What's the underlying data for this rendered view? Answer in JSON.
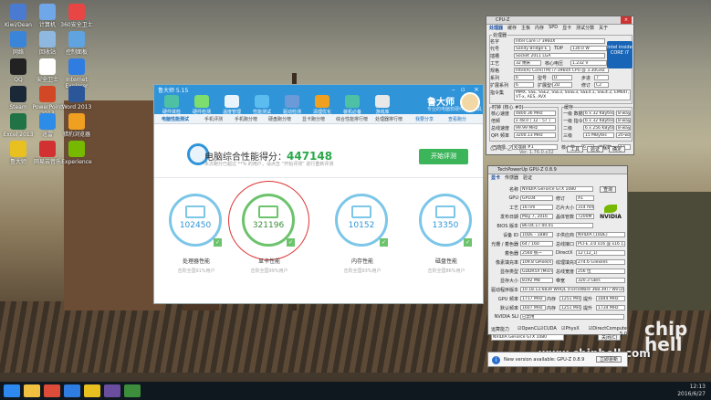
{
  "desktop": {
    "icons": [
      {
        "label": "Kiwi/Dean",
        "color": "#4a7bd0"
      },
      {
        "label": "计算机",
        "color": "#6fa7e8"
      },
      {
        "label": "360安全卫士",
        "color": "#e84545"
      },
      {
        "label": "网络",
        "color": "#3b85d8"
      },
      {
        "label": "回收站",
        "color": "#8fb8e0"
      },
      {
        "label": "控制面板",
        "color": "#5fa3e0"
      },
      {
        "label": "QQ",
        "color": "#222222"
      },
      {
        "label": "安全卫士",
        "color": "#ffffff"
      },
      {
        "label": "Internet Explorer",
        "color": "#2f7de1"
      },
      {
        "label": "Steam",
        "color": "#1b2838"
      },
      {
        "label": "PowerPoint 2013",
        "color": "#d24726"
      },
      {
        "label": "Word 2013",
        "color": "#2b579a"
      },
      {
        "label": "Excel 2013",
        "color": "#217346"
      },
      {
        "label": "迅雷",
        "color": "#2d8ce8"
      },
      {
        "label": "猎豹浏览器",
        "color": "#f0a020"
      },
      {
        "label": "鲁大师",
        "color": "#e8c020"
      },
      {
        "label": "网易云音乐",
        "color": "#d23131"
      },
      {
        "label": "Experience",
        "color": "#76b900"
      }
    ],
    "watermark": "www.chiphell.com",
    "logo_text": "chip hell"
  },
  "taskbar": {
    "time": "12:13",
    "date": "2016/6/27",
    "apps": [
      {
        "name": "start",
        "color": "#2d89ef"
      },
      {
        "name": "explorer",
        "color": "#f0c040"
      },
      {
        "name": "chrome",
        "color": "#dd4b39"
      },
      {
        "name": "ie",
        "color": "#2f7de1"
      },
      {
        "name": "ludashi",
        "color": "#e8c020"
      },
      {
        "name": "cpu-z",
        "color": "#6a4d9e"
      },
      {
        "name": "gpu-z",
        "color": "#3c8e3c"
      }
    ]
  },
  "ludashi": {
    "window_title": "鲁大师 5.15",
    "toolbar": [
      "硬件体检",
      "硬件检测",
      "温度管理",
      "性能测试",
      "驱动检测",
      "清理优化",
      "装机必备",
      "游戏库"
    ],
    "toolbar_colors": [
      "#4ec1a5",
      "#7ddd6f",
      "#e8f3fb",
      "#5bbcf0",
      "#6a9ad8",
      "#f0a020",
      "#4ec1a5",
      "#e8e8e8"
    ],
    "brand": "鲁大师",
    "brand_sub": "专业的电脑软硬件检测工具",
    "tabs": [
      "电脑性能测试",
      "手机评测",
      "手机跑分榜",
      "硬盘跑分榜",
      "显卡跑分榜",
      "综合性能排行榜",
      "处理器排行榜"
    ],
    "links": [
      "我要分享",
      "查看跑分"
    ],
    "score_label": "电脑综合性能得分：",
    "score": "447148",
    "subtitle": "本次跑分已超过 **% 的用户，请点击 “开始评测” 进行重新评测",
    "start_button": "开始评测",
    "tests": [
      {
        "value": "102450",
        "label": "处理器性能",
        "note": "击败全国91%用户"
      },
      {
        "value": "321196",
        "label": "显卡性能",
        "note": "击败全国99%用户"
      },
      {
        "value": "10152",
        "label": "内存性能",
        "note": "击败全国93%用户"
      },
      {
        "value": "13350",
        "label": "磁盘性能",
        "note": "击败全国86%用户"
      }
    ]
  },
  "cpuz": {
    "title": "CPU-Z",
    "tabs": [
      "处理器",
      "缓存",
      "主板",
      "内存",
      "SPD",
      "显卡",
      "测试分数",
      "关于"
    ],
    "group_processor": "处理器",
    "fields": [
      {
        "label": "名字",
        "value": "Intel Core i7 3960X"
      },
      {
        "label": "代号",
        "value": "Sandy Bridge-E"
      },
      {
        "label": "TDP",
        "value": "130.0 W"
      },
      {
        "label": "插槽",
        "value": "Socket 2011 LGA"
      },
      {
        "label": "工艺",
        "value": "32 纳米"
      },
      {
        "label": "核心电压",
        "value": "1.232 V"
      },
      {
        "label": "规格",
        "value": "Intel(R) Core(TM) i7-3960X CPU @ 3.30GHz"
      },
      {
        "label": "系列",
        "value": "6"
      },
      {
        "label": "型号",
        "value": "D"
      },
      {
        "label": "步进",
        "value": "7"
      },
      {
        "label": "扩展系列",
        "value": "6"
      },
      {
        "label": "扩展型号",
        "value": "2D"
      },
      {
        "label": "修订",
        "value": "C2"
      },
      {
        "label": "指令集",
        "value": "MMX, SSE, SSE2, SSE3, SSSE3, SSE4.1, SSE4.2, EM64T, VT-x, AES, AVX"
      }
    ],
    "clocks_title": "时钟 (核心 #0)",
    "clocks": [
      {
        "label": "核心速度",
        "value": "4800.36 MHz"
      },
      {
        "label": "倍频",
        "value": "x 48.0 ( 12 - 57 )"
      },
      {
        "label": "总线速度",
        "value": "99.99 MHz"
      },
      {
        "label": "QPI 频率",
        "value": "3200.13 MHz"
      }
    ],
    "cache_title": "缓存",
    "cache": [
      {
        "label": "一级 数据",
        "value": "6 x 32 KBytes",
        "way": "8-way"
      },
      {
        "label": "一级 指令",
        "value": "6 x 32 KBytes",
        "way": "8-way"
      },
      {
        "label": "二级",
        "value": "6 x 256 KBytes",
        "way": "8-way"
      },
      {
        "label": "三级",
        "value": "15 MBytes",
        "way": "20-way"
      }
    ],
    "selected_label": "已选择",
    "selected_value": "处理器 #1",
    "cores_label": "核心数",
    "cores": "6",
    "threads_label": "线程数",
    "threads": "12",
    "version": "Ver. 1.76.0.x32",
    "logo": "CPU-Z",
    "tools_button": "工具",
    "validate_button": "验证",
    "ok_button": "确定",
    "intel_badge": "intel inside CORE i7"
  },
  "gpuz": {
    "title": "TechPowerUp GPU-Z 0.8.9",
    "tabs": [
      "显卡",
      "传感器",
      "验证"
    ],
    "rows": [
      {
        "label": "名称",
        "value": "NVIDIA GeForce GTX 1080",
        "extra": "查询"
      },
      {
        "label": "GPU",
        "value": "GP104",
        "l2": "修订",
        "v2": "A1"
      },
      {
        "label": "工艺",
        "value": "16 nm",
        "l2": "芯片大小",
        "v2": "314 mm²"
      },
      {
        "label": "发布日期",
        "value": "May 7, 2016",
        "l2": "晶体管数",
        "v2": "7200M"
      },
      {
        "label": "BIOS 版本",
        "value": "86.04.17.00.01"
      },
      {
        "label": "设备 ID",
        "value": "10DE - 1B80",
        "l2": "子供应商",
        "v2": "NVIDIA (10DE)"
      },
      {
        "label": "光栅 / 着色器",
        "value": "64 / 160",
        "l2": "总线接口",
        "v2": "PCI-E 3.0 x16 @ x16 1.1"
      },
      {
        "label": "着色器",
        "value": "2560 统一",
        "l2": "DirectX",
        "v2": "12 (12_1)"
      },
      {
        "label": "像素填充率",
        "value": "109.8 GPixel/s",
        "l2": "纹理填充率",
        "v2": "274.6 GTexel/s"
      },
      {
        "label": "显存类型",
        "value": "GDDR5X (Micron)",
        "l2": "总线宽度",
        "v2": "256 位"
      },
      {
        "label": "显存大小",
        "value": "8192 MB",
        "l2": "带宽",
        "v2": "320.3 GB/s"
      },
      {
        "label": "驱动程序版本",
        "value": "10.18.13.6839 WHQL (ForceWare 368.39) / Win10 64"
      },
      {
        "label": "GPU 频率",
        "value": "1717 MHz",
        "l2": "内存",
        "v2": "1251 MHz",
        "l3": "提升",
        "v3": "1844 MHz"
      },
      {
        "label": "默认频率",
        "value": "1607 MHz",
        "l2": "内存",
        "v2": "1251 MHz",
        "l3": "提升",
        "v3": "1734 MHz"
      },
      {
        "label": "NVIDIA SLI",
        "value": "已禁用"
      }
    ],
    "compute_label": "运算能力",
    "compute": [
      "OpenCL",
      "CUDA",
      "PhysX",
      "DirectCompute 5.0"
    ],
    "select_value": "NVIDIA GeForce GTX 1080",
    "close_button": "关闭(C)",
    "brand": "NVIDIA"
  },
  "notification": {
    "text": "New version available: GPU-Z 0.8.9",
    "button": "立即更新"
  }
}
